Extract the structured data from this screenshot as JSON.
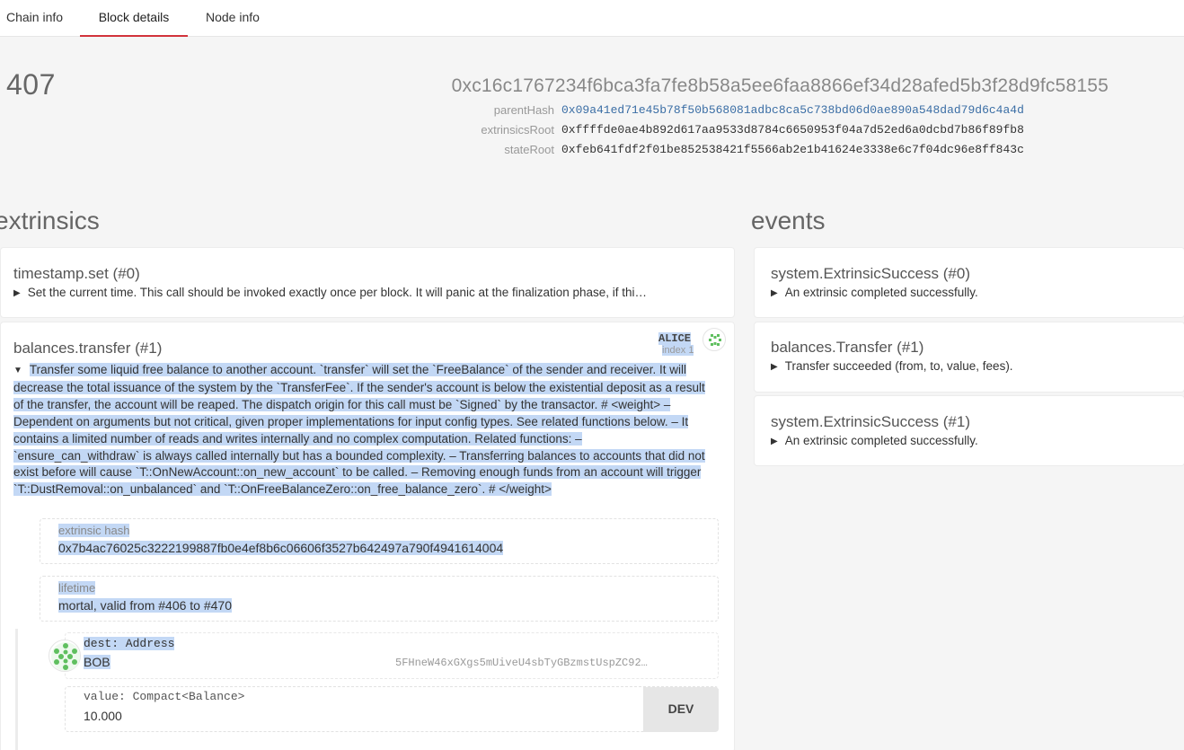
{
  "tabs": [
    {
      "label": "Chain info"
    },
    {
      "label": "Block details"
    },
    {
      "label": "Node info"
    }
  ],
  "block": {
    "number": "407",
    "hash": "0xc16c1767234f6bca3fa7fe8b58a5ee6faa8866ef34d28afed5b3f28d9fc58155",
    "parentHash_label": "parentHash",
    "parentHash": "0x09a41ed71e45b78f50b568081adbc8ca5c738bd06d0ae890a548dad79d6c4a4d",
    "extrinsicsRoot_label": "extrinsicsRoot",
    "extrinsicsRoot": "0xffffde0ae4b892d617aa9533d8784c6650953f04a7d52ed6a0dcbd7b86f89fb8",
    "stateRoot_label": "stateRoot",
    "stateRoot": "0xfeb641fdf2f01be852538421f5566ab2e1b41624e3338e6c7f04dc96e8ff843c"
  },
  "extrinsics": {
    "title": "extrinsics",
    "items": [
      {
        "title": "timestamp.set (#0)",
        "arrow": "▶",
        "description": "Set the current time. This call should be invoked exactly once per block. It will panic at the finalization phase, if thi…"
      },
      {
        "title": "balances.transfer (#1)",
        "arrow": "▼",
        "signer": "ALICE",
        "signer_index": "index 1",
        "description": "Transfer some liquid free balance to another account. `transfer` will set the `FreeBalance` of the sender and receiver. It will decrease the total issuance of the system by the `TransferFee`. If the sender's account is below the existential deposit as a result of the transfer, the account will be reaped. The dispatch origin for this call must be `Signed` by the transactor. # <weight> – Dependent on arguments but not critical, given proper implementations for input config types. See related functions below. – It contains a limited number of reads and writes internally and no complex computation. Related functions: – `ensure_can_withdraw` is always called internally but has a bounded complexity. – Transferring balances to accounts that did not exist before will cause `T::OnNewAccount::on_new_account` to be called. – Removing enough funds from an account will trigger `T::DustRemoval::on_unbalanced` and `T::OnFreeBalanceZero::on_free_balance_zero`. # </weight>",
        "hash_label": "extrinsic hash",
        "hash": "0x7b4ac76025c3222199887fb0e4ef8b6c06606f3527b642497a790f4941614004",
        "lifetime_label": "lifetime",
        "lifetime": "mortal, valid from #406 to #470",
        "dest_label": "dest: Address",
        "dest_name": "BOB",
        "dest_address": "5FHneW46xGXgs5mUiveU4sbTyGBzmstUspZC92…",
        "value_label": "value: Compact<Balance>",
        "value": "10.000",
        "unit": "DEV"
      }
    ]
  },
  "events": {
    "title": "events",
    "items": [
      {
        "title": "system.ExtrinsicSuccess (#0)",
        "arrow": "▶",
        "description": "An extrinsic completed successfully."
      },
      {
        "title": "balances.Transfer (#1)",
        "arrow": "▶",
        "description": "Transfer succeeded (from, to, value, fees)."
      },
      {
        "title": "system.ExtrinsicSuccess (#1)",
        "arrow": "▶",
        "description": "An extrinsic completed successfully."
      }
    ]
  },
  "colors": {
    "accent": "#d2333b",
    "link": "#3b6ea5",
    "selection": "#c3d8f5",
    "avatar_green": "#5fbf5f"
  }
}
